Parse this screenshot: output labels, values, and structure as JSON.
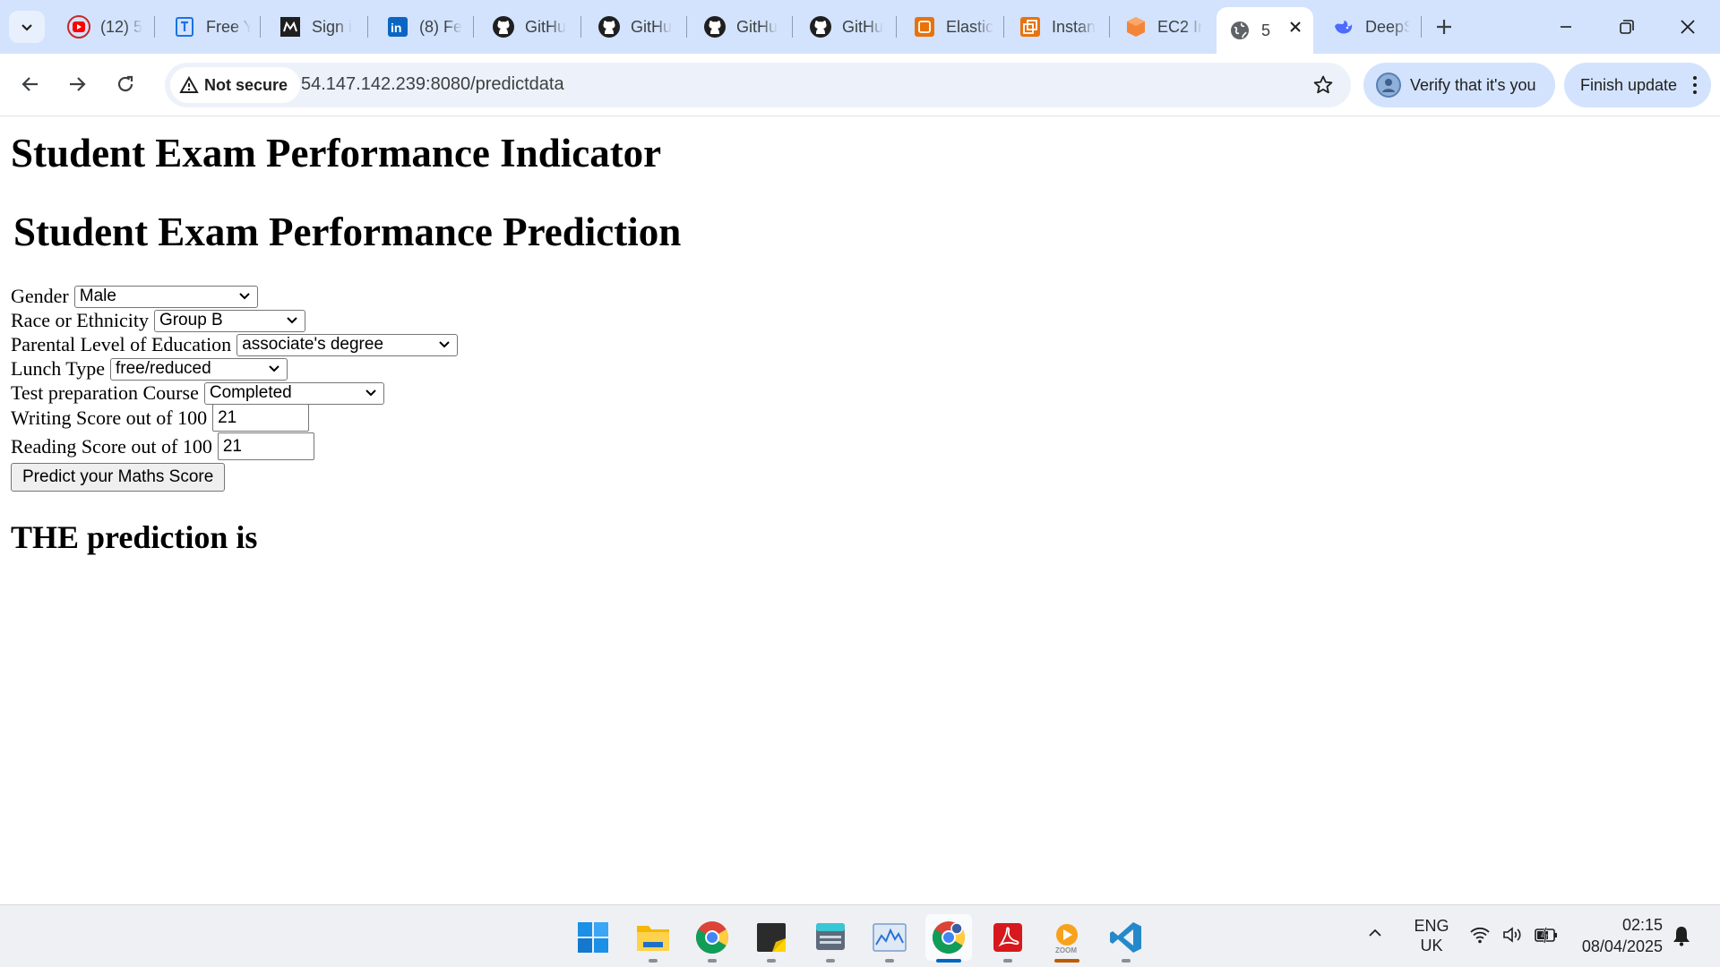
{
  "browser": {
    "tabs": [
      {
        "title": "(12) 5",
        "icon": "youtube-icon",
        "color": "#ff0000"
      },
      {
        "title": "Free Y",
        "icon": "tutorial-icon",
        "color": "#1a73e8"
      },
      {
        "title": "Sign i",
        "icon": "coursera-icon",
        "color": "#1f1f1f"
      },
      {
        "title": "(8) Fe",
        "icon": "linkedin-icon",
        "color": "#0a66c2"
      },
      {
        "title": "GitHu",
        "icon": "github-icon",
        "color": "#1f1f1f"
      },
      {
        "title": "GitHu",
        "icon": "github-icon",
        "color": "#1f1f1f"
      },
      {
        "title": "GitHu",
        "icon": "github-icon",
        "color": "#1f1f1f"
      },
      {
        "title": "GitHu",
        "icon": "github-icon",
        "color": "#1f1f1f"
      },
      {
        "title": "Elastic",
        "icon": "aws-elastic-beanstalk-icon",
        "color": "#e8720c"
      },
      {
        "title": "Instan",
        "icon": "aws-instance-icon",
        "color": "#e8720c"
      },
      {
        "title": "EC2 Ir",
        "icon": "aws-ec2-icon",
        "color": "#f58536"
      },
      {
        "title": "5",
        "icon": "globe-icon",
        "color": "#5f6368"
      },
      {
        "title": "DeepS",
        "icon": "deepseek-icon",
        "color": "#4d6bfe"
      }
    ],
    "active_tab_index": 11,
    "url": "54.147.142.239:8080/predictdata",
    "security_label": "Not secure",
    "profile_label": "Verify that it's you",
    "update_label": "Finish update"
  },
  "page": {
    "heading": "Student Exam Performance Indicator",
    "subheading": "Student Exam Performance Prediction",
    "form": {
      "gender": {
        "label": "Gender",
        "value": "Male"
      },
      "ethnicity": {
        "label": "Race or Ethnicity",
        "value": "Group B"
      },
      "education": {
        "label": "Parental Level of Education",
        "value": "associate's degree"
      },
      "lunch": {
        "label": "Lunch Type",
        "value": "free/reduced"
      },
      "test_prep": {
        "label": "Test preparation Course",
        "value": "Completed"
      },
      "writing": {
        "label": "Writing Score out of 100",
        "value": "21"
      },
      "reading": {
        "label": "Reading Score out of 100",
        "value": "21"
      },
      "submit_label": "Predict your Maths Score"
    },
    "result_label": "THE prediction is"
  },
  "taskbar": {
    "apps": [
      "windows-start-icon",
      "file-explorer-icon",
      "chrome-icon",
      "sticky-notes-icon",
      "keyboard-app-icon",
      "task-manager-icon",
      "chrome-active-icon",
      "acrobat-icon",
      "zoom-icon",
      "vscode-icon"
    ],
    "language": "ENG",
    "region": "UK",
    "time": "02:15",
    "date": "08/04/2025"
  }
}
